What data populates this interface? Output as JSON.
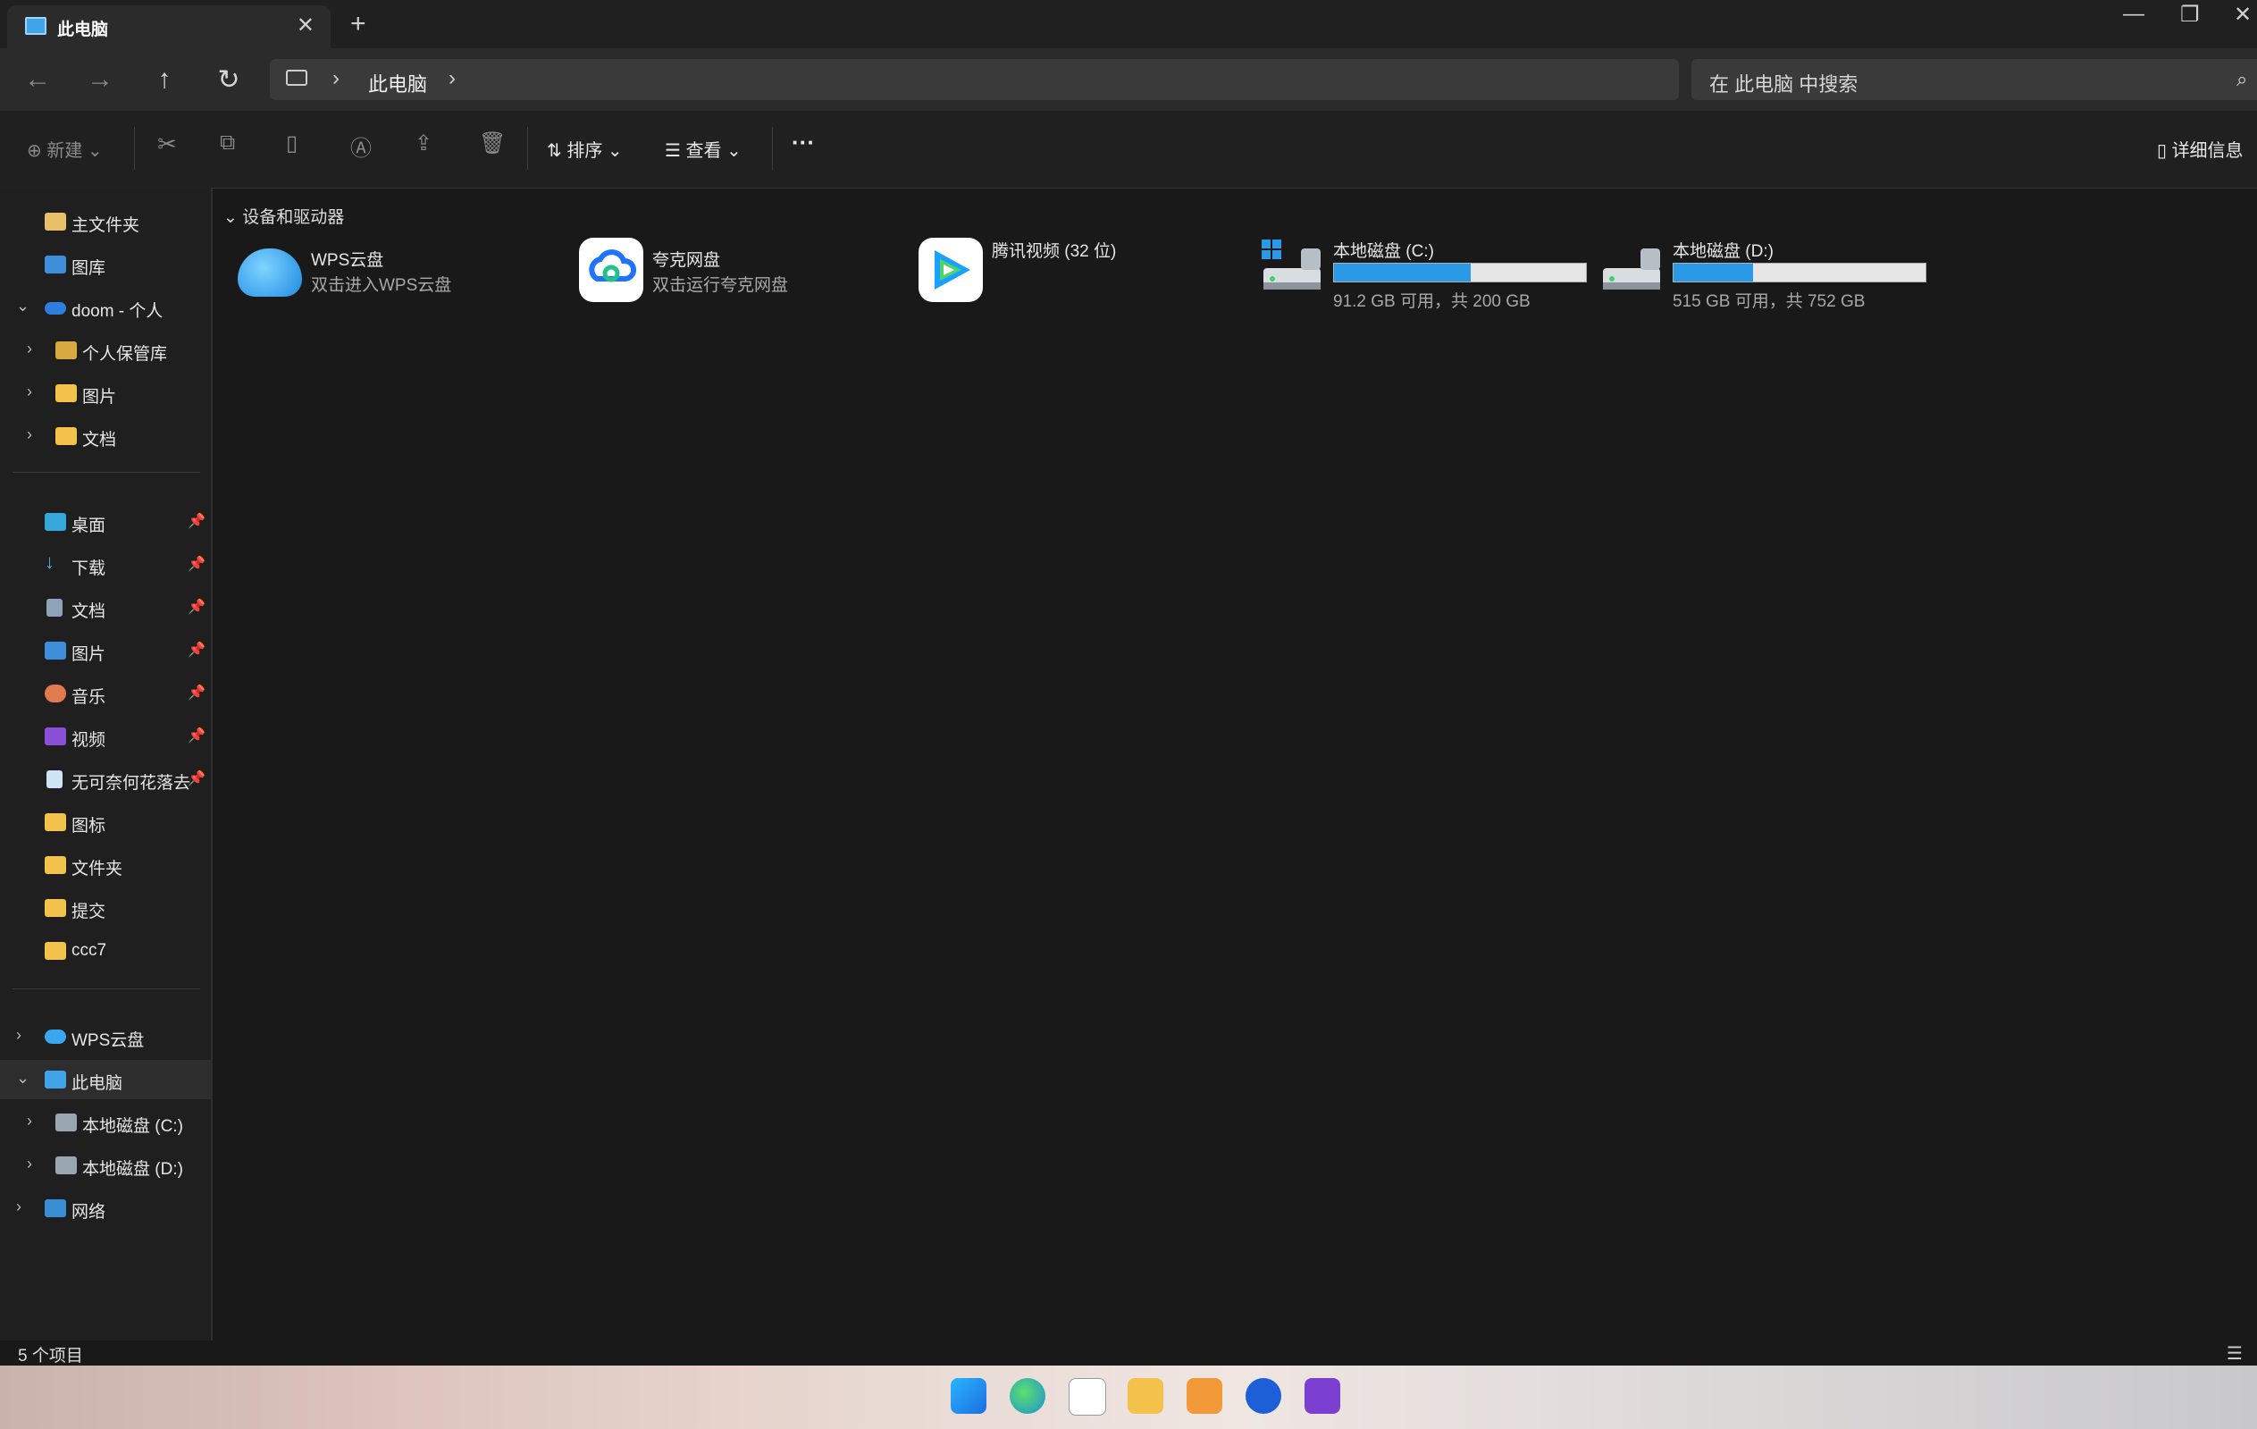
{
  "window": {
    "tab_title": "此电脑",
    "tab_close": "✕",
    "new_tab": "+",
    "minimize": "—",
    "restore": "❐",
    "close": "✕"
  },
  "nav": {
    "back": "←",
    "forward": "→",
    "up": "↑",
    "refresh": "↻",
    "breadcrumb": [
      "此电脑"
    ],
    "chevron": "›",
    "search_placeholder": "在 此电脑 中搜索",
    "search_icon": "⌕"
  },
  "toolbar": {
    "new_label": "新建",
    "sort_label": "排序",
    "view_label": "查看",
    "more_label": "···",
    "details_label": "详细信息",
    "icons": [
      "cut-icon",
      "copy-icon",
      "paste-icon",
      "rename-icon",
      "share-icon",
      "delete-icon"
    ]
  },
  "sidebar": {
    "top": [
      {
        "label": "主文件夹",
        "icon": "home-icon"
      },
      {
        "label": "图库",
        "icon": "gallery-icon"
      },
      {
        "label": "doom - 个人",
        "icon": "onedrive-icon",
        "expanded": true
      },
      {
        "label": "个人保管库",
        "icon": "vault-icon"
      },
      {
        "label": "图片",
        "icon": "folder-icon"
      },
      {
        "label": "文档",
        "icon": "folder-icon"
      }
    ],
    "pinned": [
      {
        "label": "桌面",
        "icon": "desktop-icon"
      },
      {
        "label": "下载",
        "icon": "download-icon"
      },
      {
        "label": "文档",
        "icon": "document-icon"
      },
      {
        "label": "图片",
        "icon": "pictures-icon"
      },
      {
        "label": "音乐",
        "icon": "music-icon"
      },
      {
        "label": "视频",
        "icon": "video-icon"
      },
      {
        "label": "无可奈何花落去",
        "icon": "recycle-icon"
      },
      {
        "label": "图标",
        "icon": "folder-icon"
      },
      {
        "label": "文件夹",
        "icon": "folder-icon"
      },
      {
        "label": "提交",
        "icon": "folder-icon"
      },
      {
        "label": "ccc7",
        "icon": "folder-icon"
      }
    ],
    "bottom": [
      {
        "label": "WPS云盘",
        "icon": "cloud-icon"
      },
      {
        "label": "此电脑",
        "icon": "pc-icon",
        "selected": true
      },
      {
        "label": "本地磁盘 (C:)",
        "icon": "drive-icon"
      },
      {
        "label": "本地磁盘 (D:)",
        "icon": "drive-icon"
      },
      {
        "label": "网络",
        "icon": "network-icon"
      }
    ]
  },
  "main": {
    "section_title": "设备和驱动器",
    "items": [
      {
        "name": "WPS云盘",
        "subtitle": "双击进入WPS云盘",
        "icon": "wps-cloud-icon"
      },
      {
        "name": "夸克网盘",
        "subtitle": "双击运行夸克网盘",
        "icon": "quark-cloud-icon"
      },
      {
        "name": "腾讯视频 (32 位)",
        "subtitle": "",
        "icon": "tencent-video-icon"
      }
    ],
    "drives": [
      {
        "name": "本地磁盘 (C:)",
        "usage": "91.2 GB 可用，共 200 GB",
        "used_fraction": 0.544
      },
      {
        "name": "本地磁盘 (D:)",
        "usage": "515 GB 可用，共 752 GB",
        "used_fraction": 0.315
      }
    ]
  },
  "status": {
    "item_count": "5 个项目"
  },
  "colors": {
    "accent": "#2b9ae6",
    "background": "#191919",
    "sidebar": "#1f1f1f"
  }
}
